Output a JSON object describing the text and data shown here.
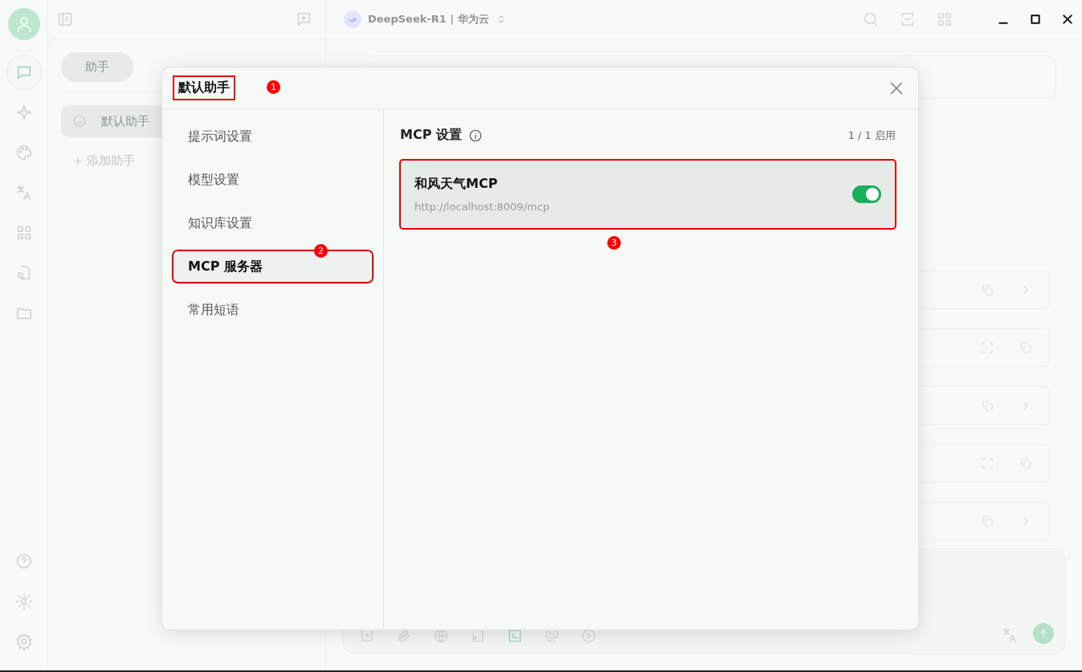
{
  "nav_rail": {
    "items": [
      {
        "selected": true
      },
      {
        "selected": false
      },
      {
        "selected": false
      },
      {
        "selected": false
      },
      {
        "selected": false
      },
      {
        "selected": false
      },
      {
        "selected": false
      }
    ]
  },
  "app_bar": {
    "model": "DeepSeek-R1 | 华为云"
  },
  "assistant_panel": {
    "tabs": [
      {
        "label": "助手",
        "selected": true
      }
    ],
    "assistants": [
      {
        "name": "默认助手",
        "selected": true
      }
    ],
    "add_button": "添加助手"
  },
  "dialog": {
    "title": "默认助手",
    "title_callout": "1",
    "nav": [
      {
        "label": "提示词设置",
        "selected": false
      },
      {
        "label": "模型设置",
        "selected": false
      },
      {
        "label": "知识库设置",
        "selected": false
      },
      {
        "label": "MCP 服务器",
        "selected": true,
        "callout": "2"
      },
      {
        "label": "常用短语",
        "selected": false
      }
    ],
    "section": {
      "title": "MCP 设置",
      "count": "1 / 1 启用"
    },
    "servers": [
      {
        "name": "和风天气MCP",
        "url": "http://localhost:8009/mcp",
        "on": true,
        "callout": "3"
      }
    ]
  }
}
